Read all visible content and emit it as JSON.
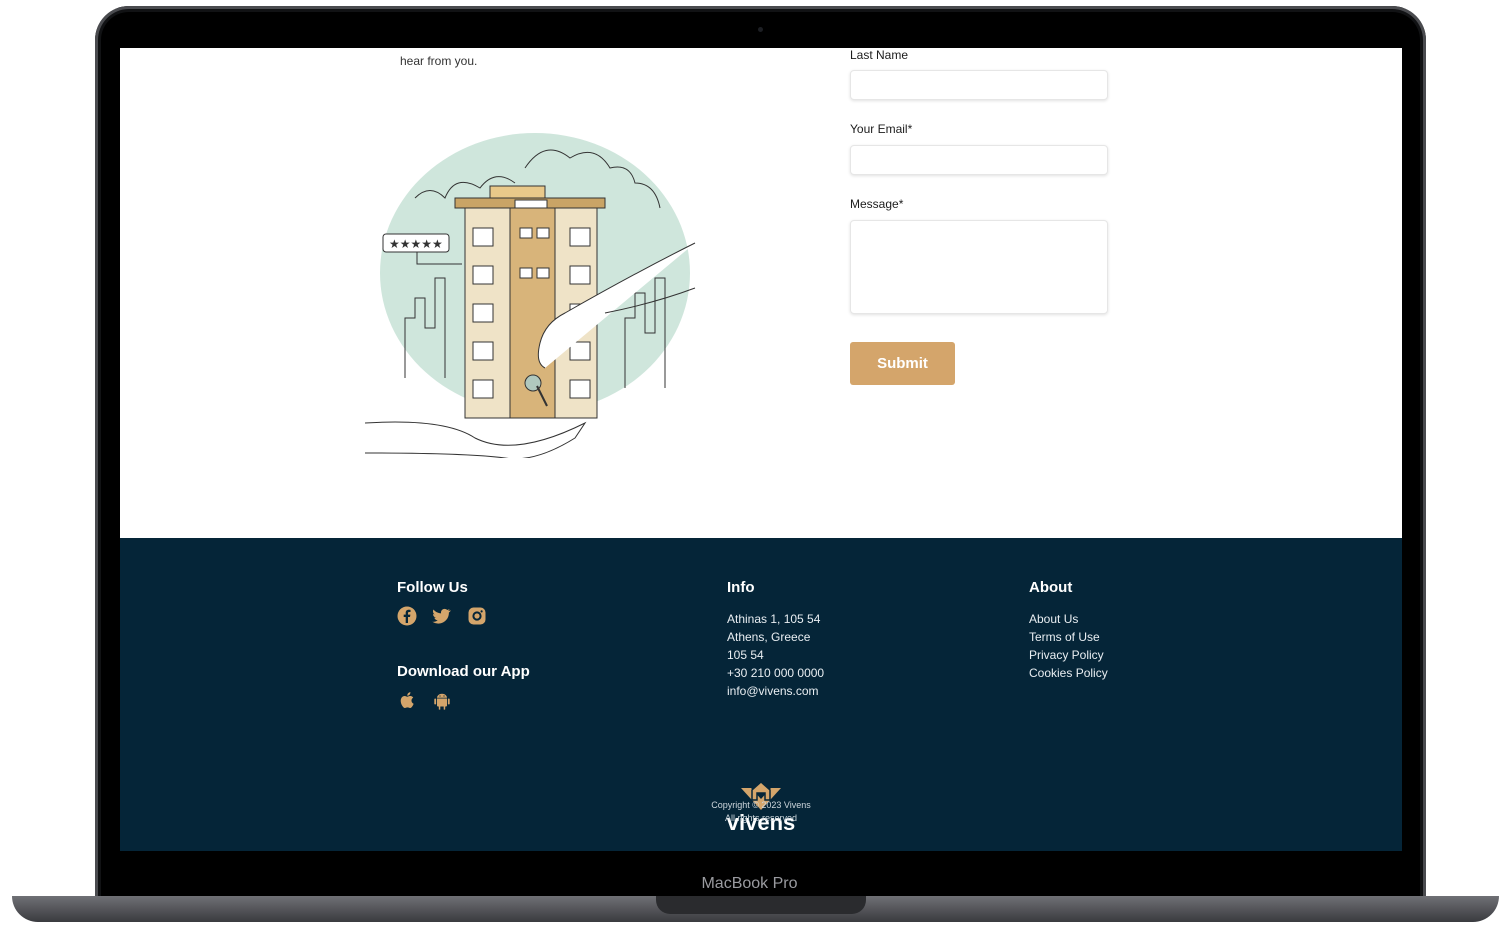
{
  "device": {
    "label": "MacBook Pro"
  },
  "intro": {
    "text": "hear from you."
  },
  "form": {
    "last_name_label": "Last Name",
    "email_label": "Your Email*",
    "message_label": "Message*",
    "submit_label": "Submit"
  },
  "illustration": {
    "rating_stars": 5
  },
  "footer": {
    "follow_heading": "Follow Us",
    "social_icons": [
      "facebook-icon",
      "twitter-icon",
      "instagram-icon"
    ],
    "app_heading": "Download our App",
    "app_icons": [
      "apple-icon",
      "android-icon"
    ],
    "info_heading": "Info",
    "info_lines": [
      "Athinas 1, 105 54",
      "Athens, Greece",
      "105 54",
      "+30 210 000 0000",
      "info@vivens.com"
    ],
    "about_heading": "About",
    "about_links": [
      "About Us",
      "Terms of Use",
      "Privacy Policy",
      "Cookies Policy"
    ],
    "brand": "vivens",
    "copyright_line1": "Copyright © 2023 Vivens",
    "copyright_line2": "All rights reserved"
  },
  "colors": {
    "accent": "#d4a56b",
    "footer_bg": "#052538"
  }
}
